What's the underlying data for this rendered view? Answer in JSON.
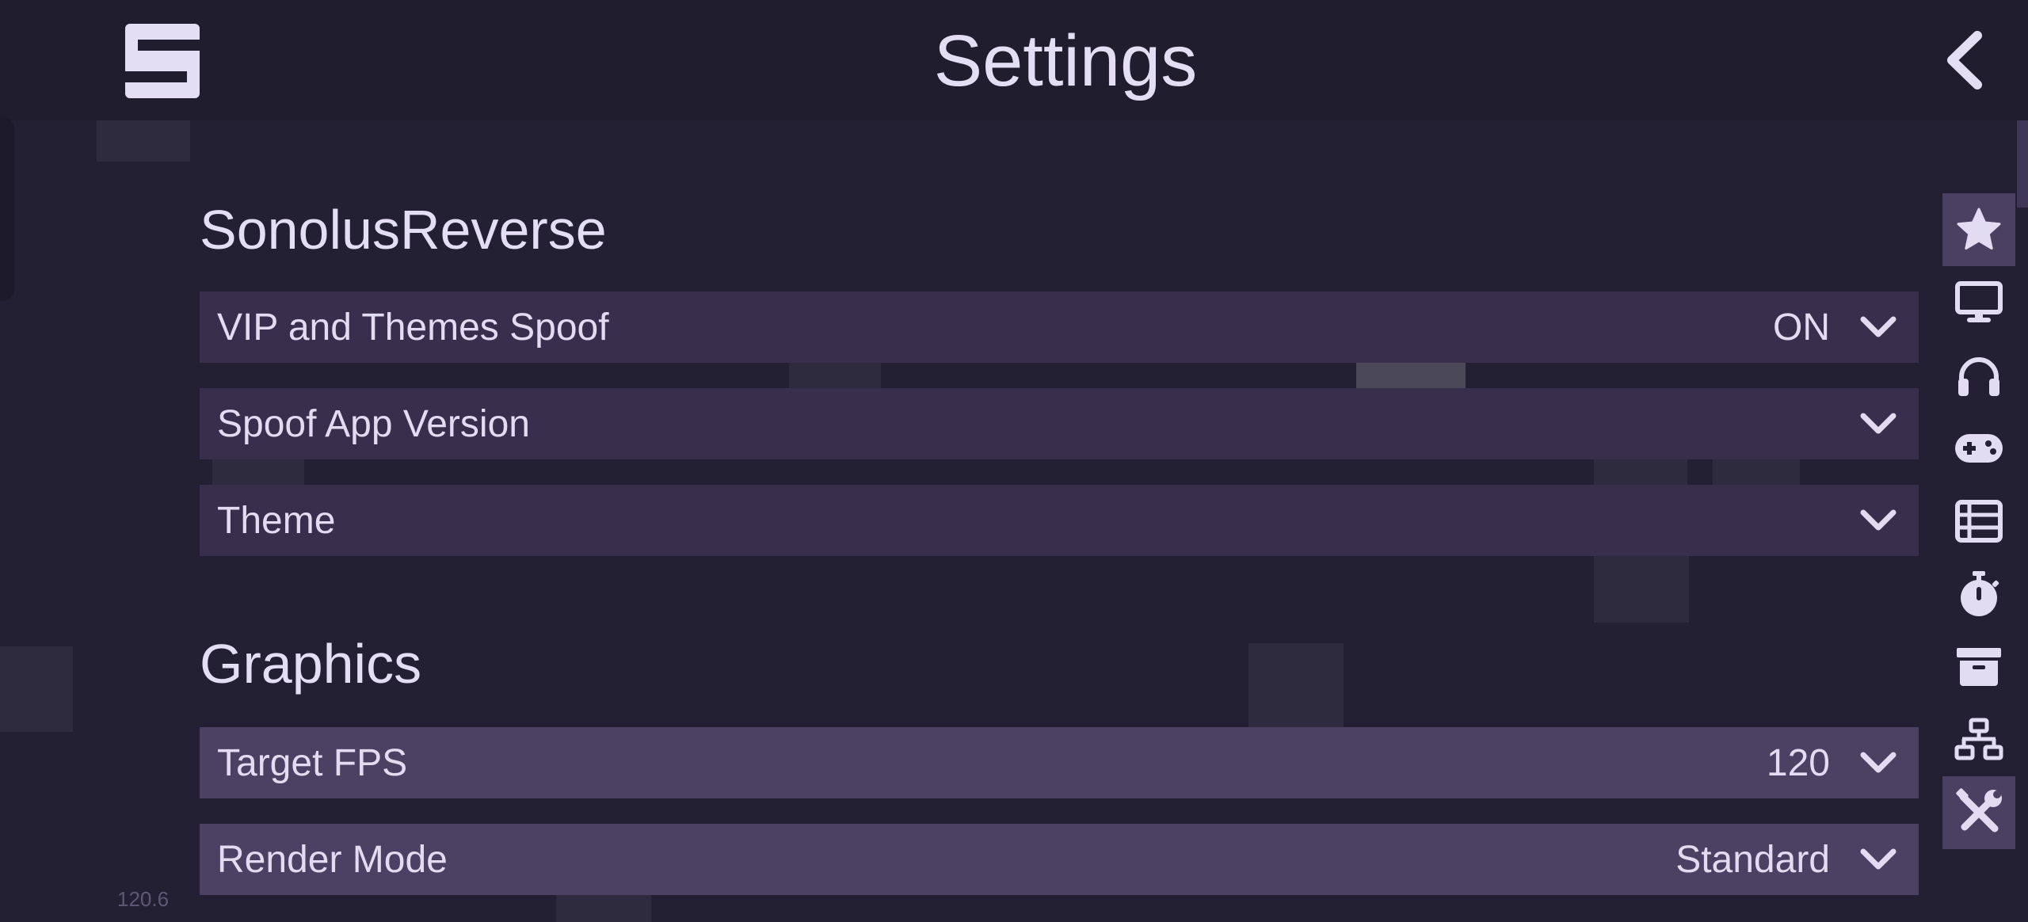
{
  "header": {
    "title": "Settings"
  },
  "icons": {
    "logo": "sonolus-logo-icon",
    "back": "chevron-left-icon",
    "dropdown": "chevron-down-icon"
  },
  "sections": [
    {
      "title": "SonolusReverse",
      "rows": [
        {
          "label": "VIP and Themes Spoof",
          "value": "ON"
        },
        {
          "label": "Spoof App Version",
          "value": ""
        },
        {
          "label": "Theme",
          "value": ""
        }
      ]
    },
    {
      "title": "Graphics",
      "rows": [
        {
          "label": "Target FPS",
          "value": "120"
        },
        {
          "label": "Render Mode",
          "value": "Standard"
        }
      ]
    }
  ],
  "side_nav": [
    {
      "icon": "star-icon",
      "active": true
    },
    {
      "icon": "monitor-icon",
      "active": false
    },
    {
      "icon": "headphones-icon",
      "active": false
    },
    {
      "icon": "gamepad-icon",
      "active": false
    },
    {
      "icon": "list-icon",
      "active": false
    },
    {
      "icon": "stopwatch-icon",
      "active": false
    },
    {
      "icon": "archive-icon",
      "active": false
    },
    {
      "icon": "network-icon",
      "active": false
    },
    {
      "icon": "tools-icon",
      "active": true
    }
  ],
  "fps_counter": "120.6",
  "colors": {
    "background": "#221f31",
    "header": "#201d2e",
    "row_dim": "#372f4b",
    "row_bright": "#4b4163",
    "text": "#e2dcf2",
    "nav_active": "#4a4062"
  }
}
